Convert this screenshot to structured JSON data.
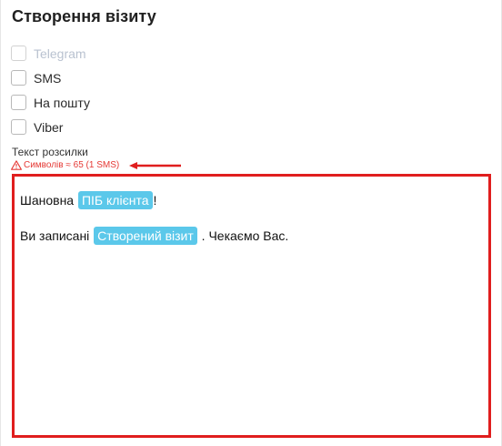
{
  "title": "Створення візиту",
  "channels": [
    {
      "label": "Telegram",
      "checked": false,
      "disabled": true
    },
    {
      "label": "SMS",
      "checked": false,
      "disabled": false
    },
    {
      "label": "На пошту",
      "checked": false,
      "disabled": false
    },
    {
      "label": "Viber",
      "checked": false,
      "disabled": false
    }
  ],
  "message": {
    "label": "Текст розсилки",
    "warning": "Символів ≈ 65 (1 SMS)",
    "line1_prefix": "Шановна ",
    "line1_token": "ПІБ клієнта",
    "line1_suffix": "!",
    "line2_prefix": "Ви записані ",
    "line2_token": "Створений візит",
    "line2_suffix": " . Чекаємо Вас."
  },
  "colors": {
    "token_bg": "#5bc8ea",
    "highlight": "#e01e1e",
    "warning": "#e53935"
  },
  "icons": [
    "warning-triangle-icon",
    "arrow-left-icon"
  ]
}
